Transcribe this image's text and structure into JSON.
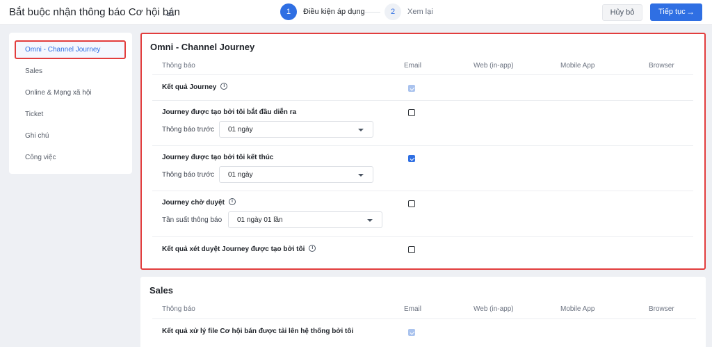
{
  "header": {
    "title": "Bắt buộc nhận thông báo Cơ hội bán",
    "steps": [
      {
        "number": "1",
        "label": "Điều kiện áp dụng"
      },
      {
        "number": "2",
        "label": "Xem lại"
      }
    ],
    "cancel_label": "Hủy bỏ",
    "continue_label": "Tiếp tục",
    "continue_icon": "→"
  },
  "sidebar": {
    "items": [
      {
        "label": "Omni - Channel Journey"
      },
      {
        "label": "Sales"
      },
      {
        "label": "Online & Mạng xã hội"
      },
      {
        "label": "Ticket"
      },
      {
        "label": "Ghi chú"
      },
      {
        "label": "Công việc"
      }
    ]
  },
  "columns": {
    "notification": "Thông báo",
    "email": "Email",
    "web": "Web (in-app)",
    "mobile": "Mobile App",
    "browser": "Browser"
  },
  "omni": {
    "title": "Omni - Channel Journey",
    "rows": [
      {
        "label": "Kết quả Journey",
        "email": "checked-disabled"
      },
      {
        "label": "Journey được tạo bởi tôi bắt đầu diễn ra",
        "email": "unchecked",
        "sub_label": "Thông báo trước",
        "select_value": "01 ngày"
      },
      {
        "label": "Journey được tạo bởi tôi kết thúc",
        "email": "checked",
        "sub_label": "Thông báo trước",
        "select_value": "01 ngày"
      },
      {
        "label": "Journey chờ duyệt",
        "email": "unchecked",
        "sub_label": "Tần suất thông báo",
        "select_value": "01 ngày 01 lần"
      },
      {
        "label": "Kết quả xét duyệt Journey được tạo bởi tôi",
        "email": "unchecked"
      }
    ]
  },
  "sales": {
    "title": "Sales",
    "rows": [
      {
        "label": "Kết quả xử lý file Cơ hội bán được tải lên hệ thống bởi tôi",
        "email": "checked-disabled"
      }
    ]
  },
  "colors": {
    "accent": "#2f6fe3",
    "highlight_border": "#e23d3d"
  },
  "info_glyph": "i"
}
